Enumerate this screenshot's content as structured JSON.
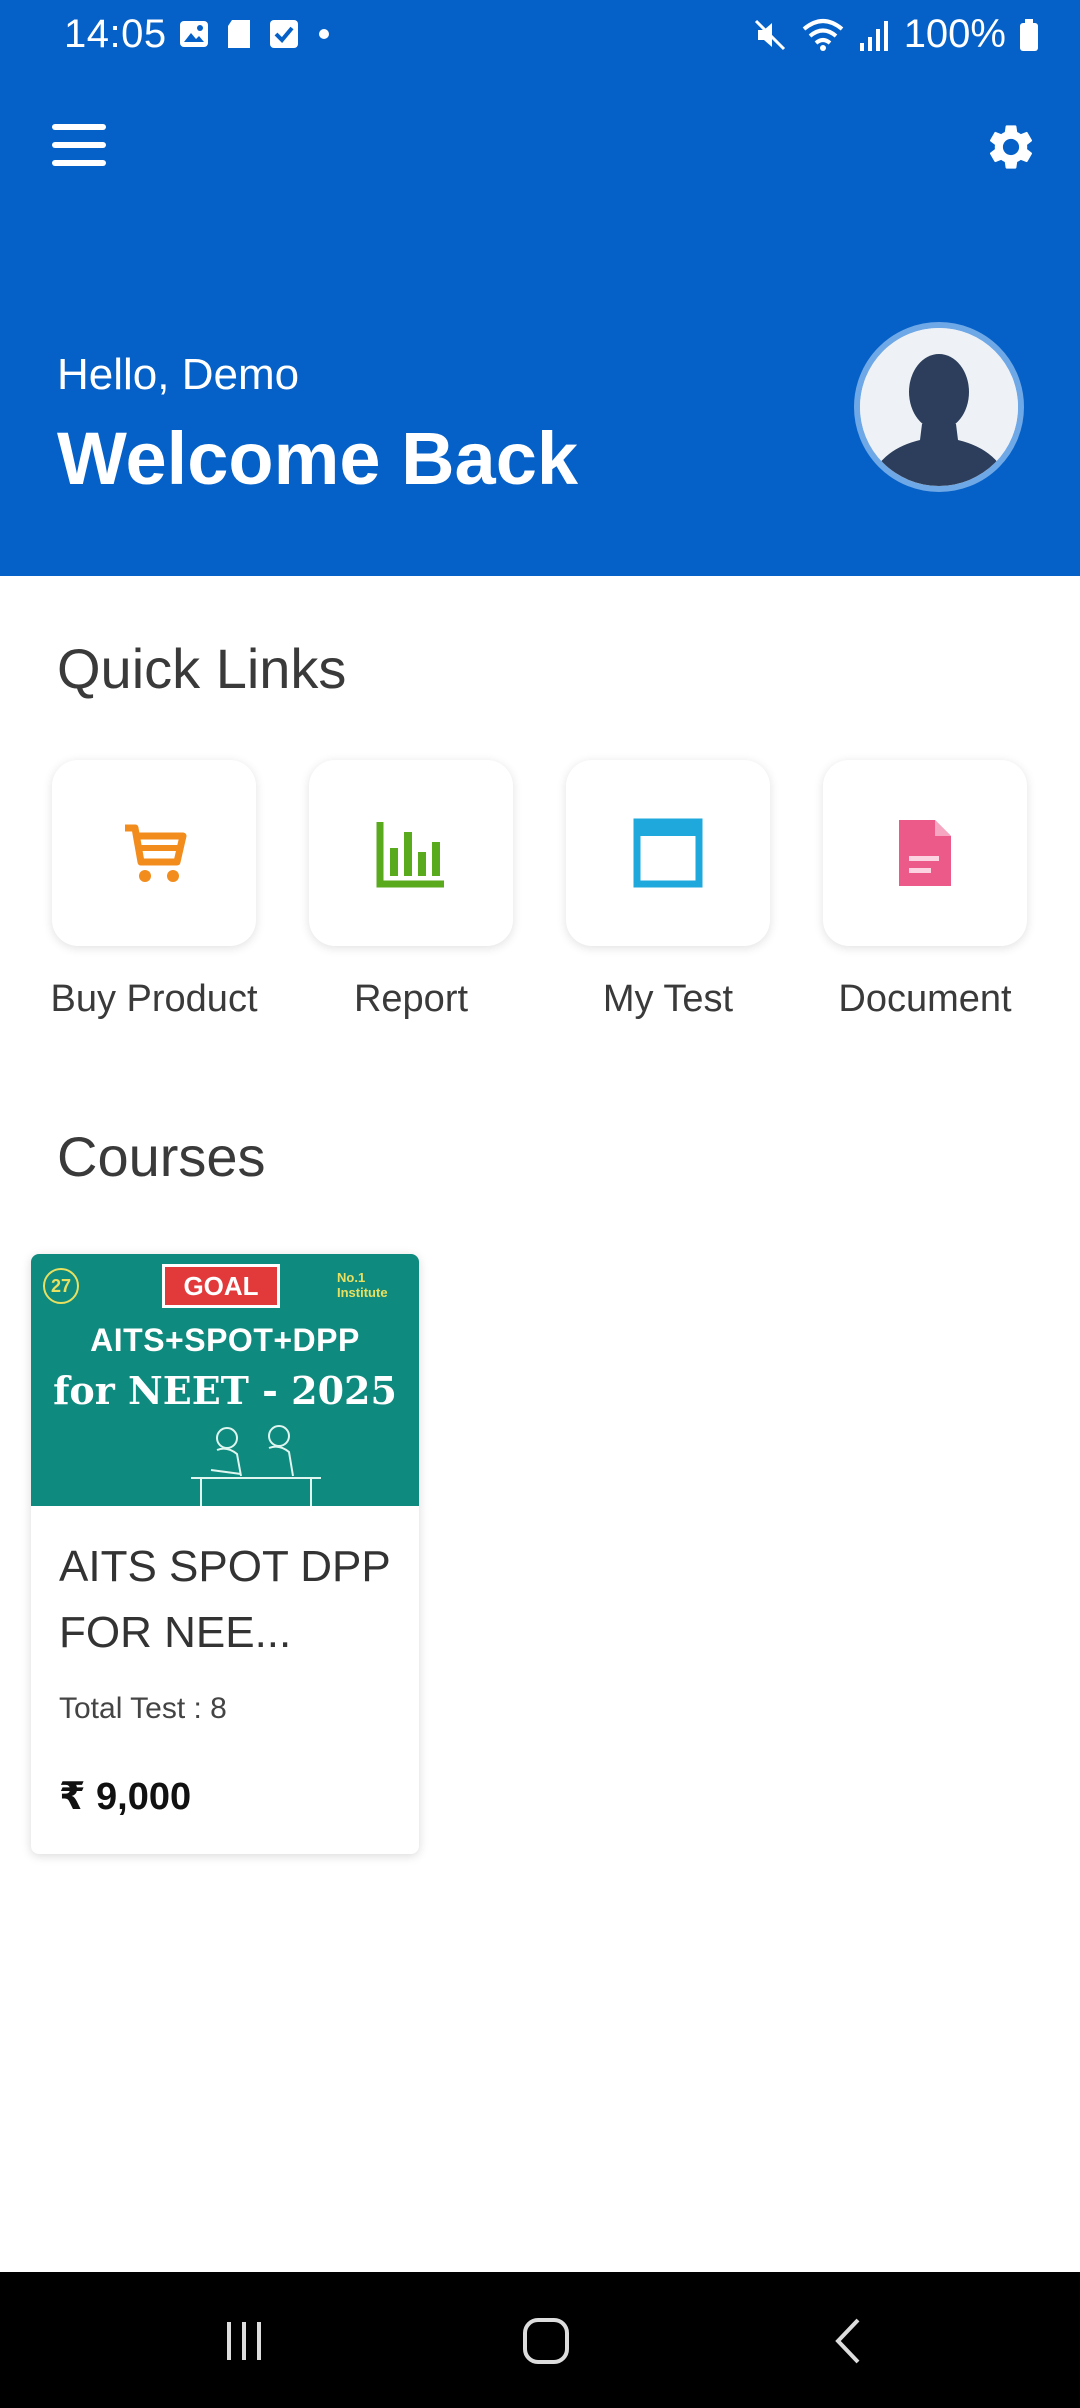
{
  "status": {
    "time": "14:05",
    "battery": "100%"
  },
  "header": {
    "greeting": "Hello, Demo",
    "welcome": "Welcome Back"
  },
  "quick_links": {
    "title": "Quick Links",
    "items": [
      {
        "label": "Buy Product",
        "icon": "cart-icon",
        "color": "#f28c1d"
      },
      {
        "label": "Report",
        "icon": "bar-chart-icon",
        "color": "#5aaa1e"
      },
      {
        "label": "My Test",
        "icon": "browser-window-icon",
        "color": "#1fa8dc"
      },
      {
        "label": "Document",
        "icon": "document-icon",
        "color": "#ec5a8a"
      }
    ]
  },
  "courses": {
    "title": "Courses",
    "items": [
      {
        "title": "AITS  SPOT DPP FOR NEE...",
        "meta": "Total Test : 8",
        "price": "₹ 9,000",
        "banner": {
          "logo": "GOAL",
          "badge": "27",
          "institute": "No.1 Institute",
          "line1": "AITS+SPOT+DPP",
          "line2": "for NEET - 2025"
        }
      }
    ]
  },
  "colors": {
    "header": "#0561c8"
  }
}
